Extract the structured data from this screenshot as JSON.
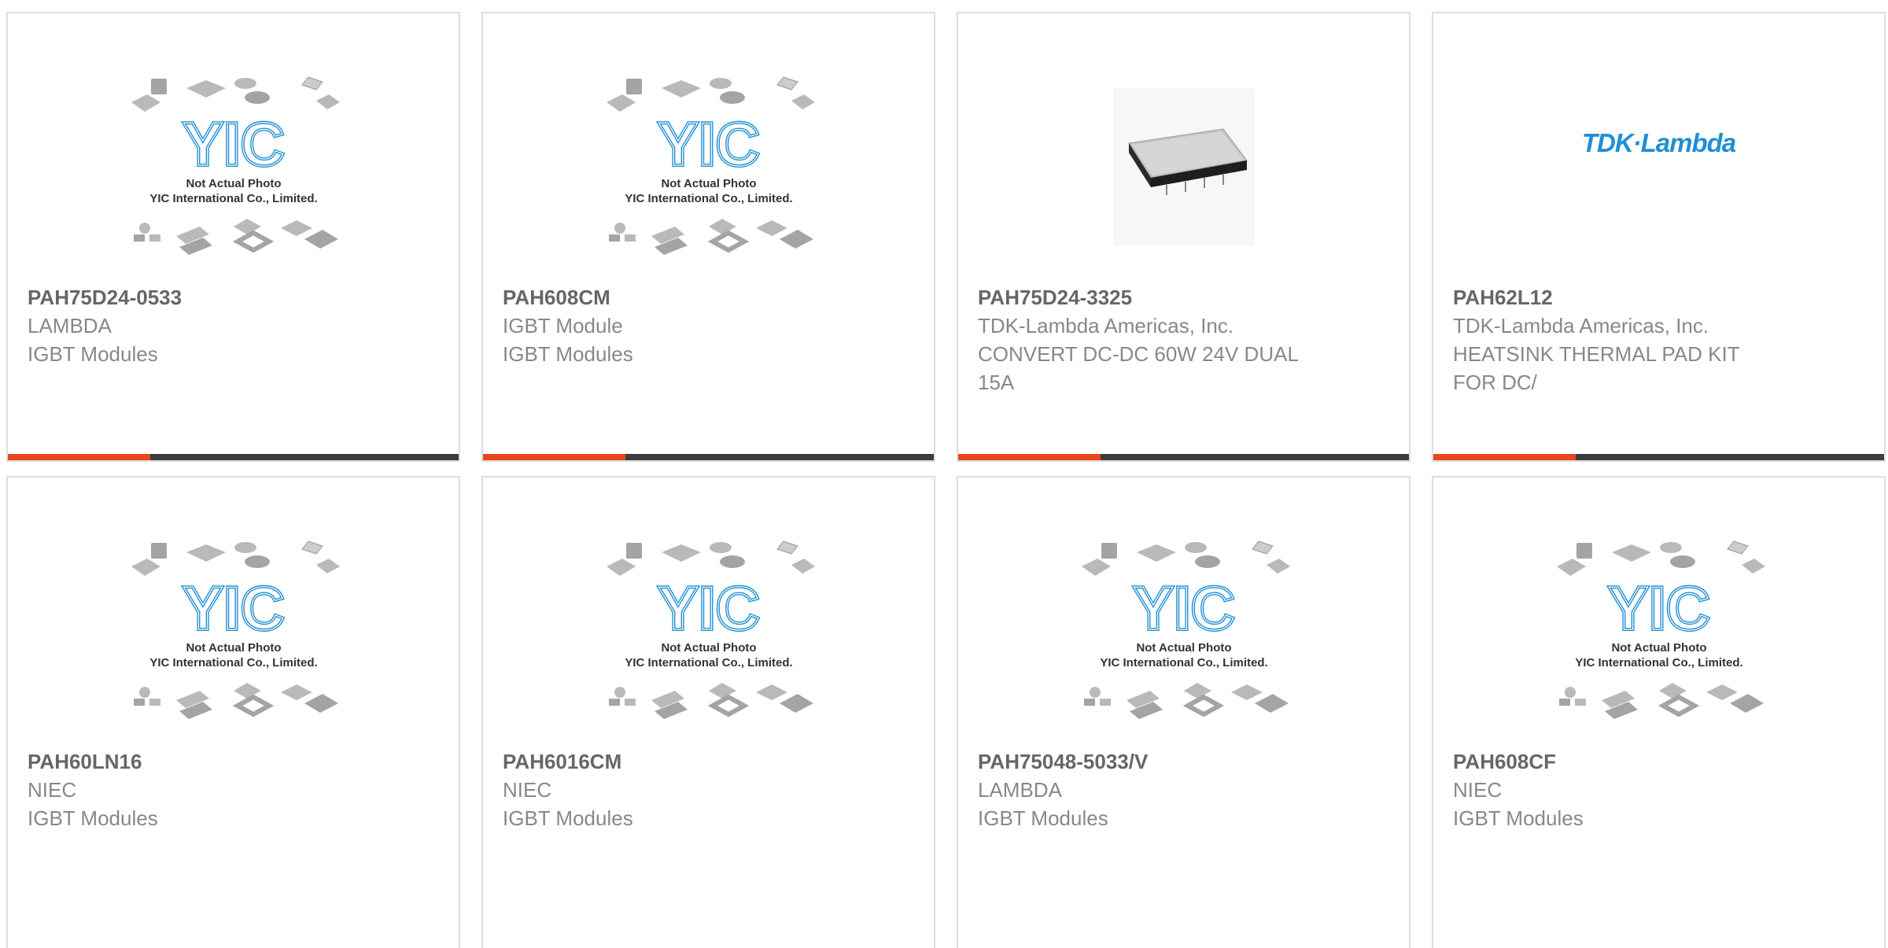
{
  "colors": {
    "accent": "#e8461f",
    "bar": "#3d3d3d",
    "border": "#dedede",
    "logo_blue": "#1f8fd4"
  },
  "placeholder": {
    "line1": "Not Actual Photo",
    "line2": "YIC International Co., Limited.",
    "logo_text": "YIC"
  },
  "products": [
    {
      "part": "PAH75D24-0533",
      "maker": "LAMBDA",
      "desc": "IGBT Modules",
      "image": "yic-placeholder"
    },
    {
      "part": "PAH608CM",
      "maker": "IGBT Module",
      "desc": "IGBT Modules",
      "image": "yic-placeholder"
    },
    {
      "part": "PAH75D24-3325",
      "maker": "TDK-Lambda Americas, Inc.",
      "desc": "CONVERT DC-DC 60W 24V DUAL 15A",
      "image": "dc-dc-converter-photo"
    },
    {
      "part": "PAH62L12",
      "maker": "TDK-Lambda Americas, Inc.",
      "desc": "HEATSINK THERMAL PAD KIT FOR DC/",
      "image": "tdk-lambda-logo",
      "logo_text": "TDK·Lambda"
    },
    {
      "part": "PAH60LN16",
      "maker": "NIEC",
      "desc": "IGBT Modules",
      "image": "yic-placeholder"
    },
    {
      "part": "PAH6016CM",
      "maker": "NIEC",
      "desc": "IGBT Modules",
      "image": "yic-placeholder"
    },
    {
      "part": "PAH75048-5033/V",
      "maker": "LAMBDA",
      "desc": "IGBT Modules",
      "image": "yic-placeholder"
    },
    {
      "part": "PAH608CF",
      "maker": "NIEC",
      "desc": "IGBT Modules",
      "image": "yic-placeholder"
    }
  ]
}
